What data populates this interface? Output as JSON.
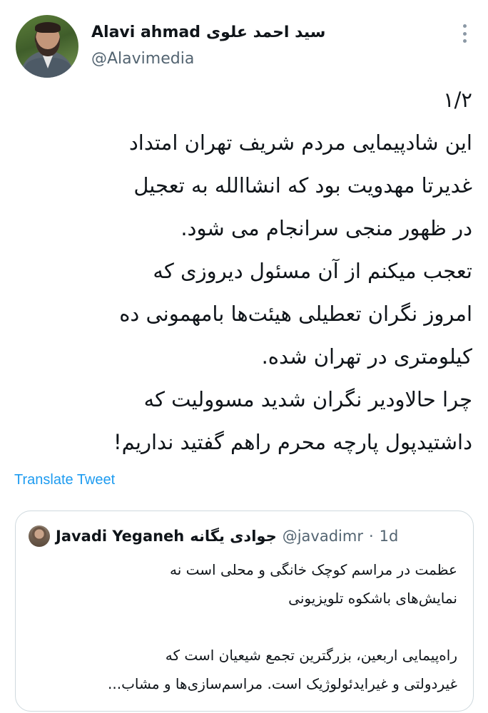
{
  "author": {
    "name": "Alavi ahmad",
    "name_fa": "سید احمد علوی",
    "handle": "@Alavimedia"
  },
  "tweet": {
    "lines": [
      "۱/۲",
      "این شادپیمایی مردم شریف تهران امتداد",
      "غدیرتا مهدویت بود که انشاالله به تعجیل",
      "در ظهور منجی سرانجام می شود.",
      "تعجب میکنم از آن مسئول دیروزی که",
      "امروز نگران تعطیلی هیئت‌ها بامهمونی ده",
      "کیلومتری در تهران شده.",
      "چرا حالاودیر نگران شدید مسوولیت که",
      "داشتیدپول پارچه محرم راهم گفتید نداریم!"
    ]
  },
  "translate_label": "Translate Tweet",
  "quote": {
    "name": "Javadi Yeganeh",
    "name_fa": "جوادی یگانه",
    "handle": "@javadimr",
    "separator": "·",
    "time": "1d",
    "lines": [
      "عظمت در مراسم کوچک خانگی و محلی  است نه",
      "نمایش‌های باشکوه تلویزیونی",
      "",
      "راه‌پیمایی اربعین، بزرگترین تجمع شیعیان است که",
      "غیردولتی و غیرایدئولوژیک است. مراسم‌سازی‌ها و مشاب..."
    ]
  },
  "icons": {
    "more": "more-vertical-icon"
  }
}
